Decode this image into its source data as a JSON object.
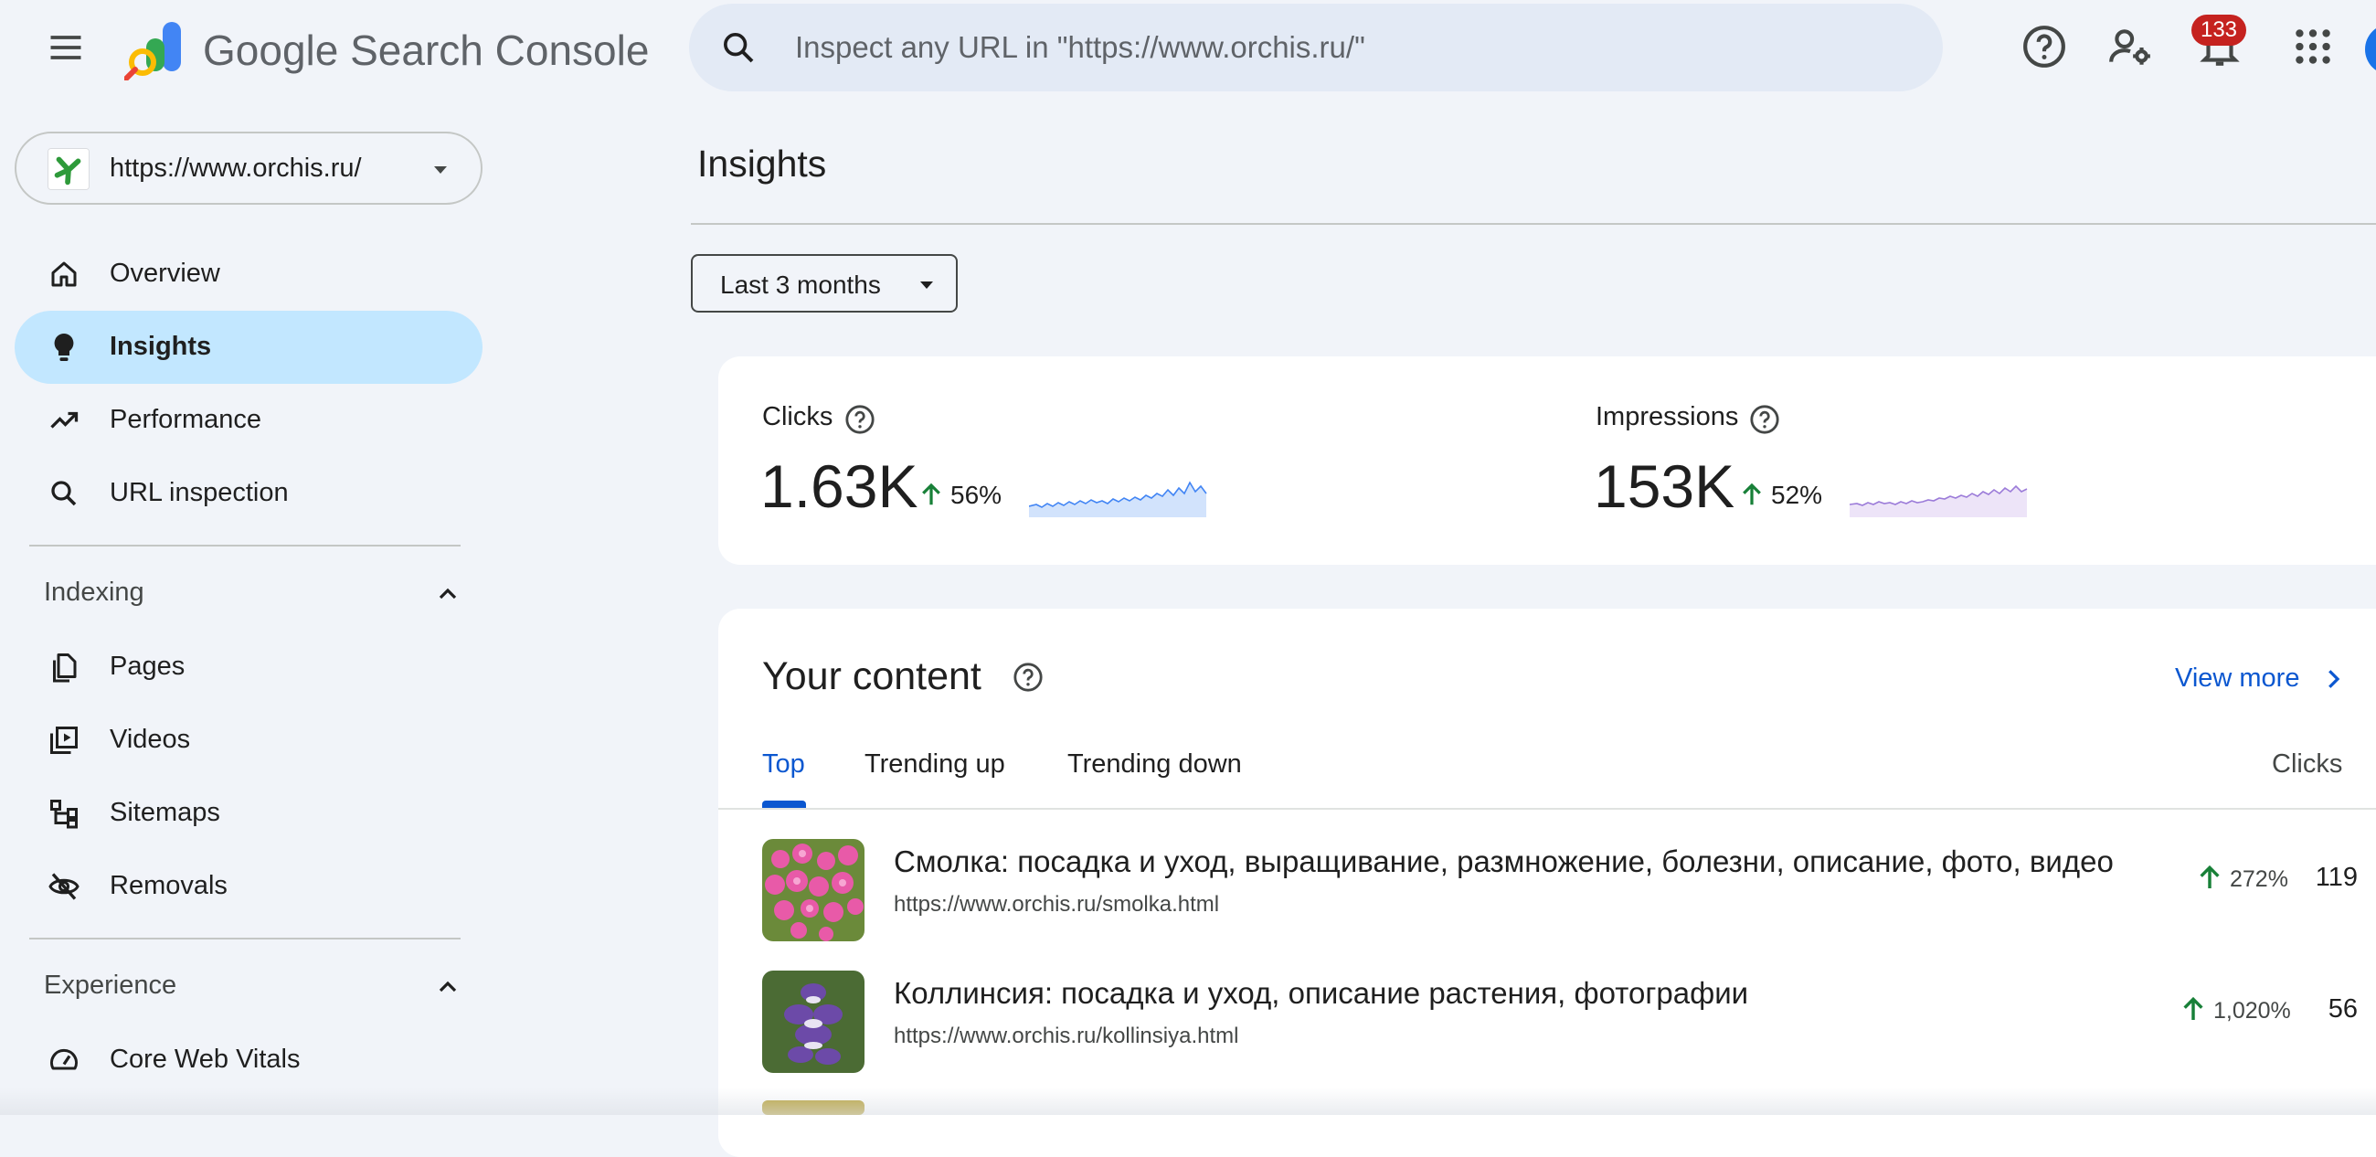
{
  "header": {
    "product_name": "Google Search Console",
    "search_placeholder": "Inspect any URL in \"https://www.orchis.ru/\"",
    "notification_count": "133"
  },
  "property": {
    "label": "https://www.orchis.ru/"
  },
  "sidebar": {
    "items": [
      {
        "label": "Overview",
        "icon": "home-icon"
      },
      {
        "label": "Insights",
        "icon": "lightbulb-icon",
        "active": true
      },
      {
        "label": "Performance",
        "icon": "trending-up-icon"
      },
      {
        "label": "URL inspection",
        "icon": "search-icon"
      }
    ],
    "indexing": {
      "label": "Indexing",
      "items": [
        {
          "label": "Pages",
          "icon": "pages-icon"
        },
        {
          "label": "Videos",
          "icon": "video-library-icon"
        },
        {
          "label": "Sitemaps",
          "icon": "sitemap-icon"
        },
        {
          "label": "Removals",
          "icon": "visibility-off-icon"
        }
      ]
    },
    "experience": {
      "label": "Experience",
      "items": [
        {
          "label": "Core Web Vitals",
          "icon": "speed-gauge-icon"
        }
      ]
    }
  },
  "main": {
    "title": "Insights",
    "date_range": "Last 3 months",
    "metrics": [
      {
        "label": "Clicks",
        "value": "1.63K",
        "change": "56%",
        "color": "#4285f4"
      },
      {
        "label": "Impressions",
        "value": "153K",
        "change": "52%",
        "color": "#9c7cd9"
      }
    ],
    "content": {
      "title": "Your content",
      "view_more": "View more",
      "tabs": [
        "Top",
        "Trending up",
        "Trending down"
      ],
      "column": "Clicks",
      "rows": [
        {
          "title": "Смолка: посадка и уход, выращивание, размножение, болезни, описание, фото, видео",
          "url": "https://www.orchis.ru/smolka.html",
          "change": "272%",
          "clicks": "119"
        },
        {
          "title": "Коллинсия: посадка и уход, описание растения, фотографии",
          "url": "https://www.orchis.ru/kollinsiya.html",
          "change": "1,020%",
          "clicks": "56"
        }
      ]
    }
  },
  "colors": {
    "accent": "#0b57d0",
    "active_nav": "#c2e7ff",
    "positive": "#188038",
    "badge": "#c5221f"
  }
}
